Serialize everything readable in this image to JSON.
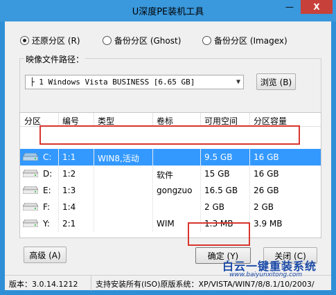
{
  "window": {
    "title": "U深度PE装机工具",
    "controls": {
      "minimize": "—",
      "maximize": "☐",
      "close": "X"
    }
  },
  "mode_options": [
    {
      "label": "还原分区 (R)",
      "checked": true
    },
    {
      "label": "备份分区 (Ghost)",
      "checked": false
    },
    {
      "label": "备份分区 (Imagex)",
      "checked": false
    }
  ],
  "image_path": {
    "legend": "映像文件路径：",
    "value": "├ 1 Windows Vista BUSINESS [6.65 GB]",
    "browse_label": "浏览 (B)"
  },
  "partition_table": {
    "columns": [
      "分区",
      "编号",
      "类型",
      "卷标",
      "可用空间",
      "分区容量"
    ],
    "rows": [
      {
        "drive": "C:",
        "index": "1:1",
        "type": "WIN8,活动",
        "label": "",
        "free": "9.5 GB",
        "size": "16 GB",
        "selected": true
      },
      {
        "drive": "D:",
        "index": "1:2",
        "type": "",
        "label": "软件",
        "free": "15 GB",
        "size": "16 GB",
        "selected": false
      },
      {
        "drive": "E:",
        "index": "1:3",
        "type": "",
        "label": "gongzuo",
        "free": "16.5 GB",
        "size": "26 GB",
        "selected": false
      },
      {
        "drive": "F:",
        "index": "1:4",
        "type": "",
        "label": "",
        "free": "2 GB",
        "size": "2 GB",
        "selected": false
      },
      {
        "drive": "Y:",
        "index": "2:1",
        "type": "",
        "label": "WIM",
        "free": "1.3 MB",
        "size": "3.9 MB",
        "selected": false
      }
    ]
  },
  "buttons": {
    "advanced": "高级 (A)",
    "ok": "确定 (Y)",
    "close": "关闭 (C)"
  },
  "status": {
    "version": "版本：3.0.14.1212",
    "support": "支持安装所有(ISO)原版系统：XP/VISTA/WIN7/8/8.1/10/2003/"
  },
  "watermark": {
    "title": "白云一键重装系统",
    "url": "www.baiyunxitong.com"
  },
  "colors": {
    "selection": "#3399ff",
    "annotation_red": "#d8342c",
    "titlebar": "#3a98dc",
    "close_button": "#c7413a"
  }
}
